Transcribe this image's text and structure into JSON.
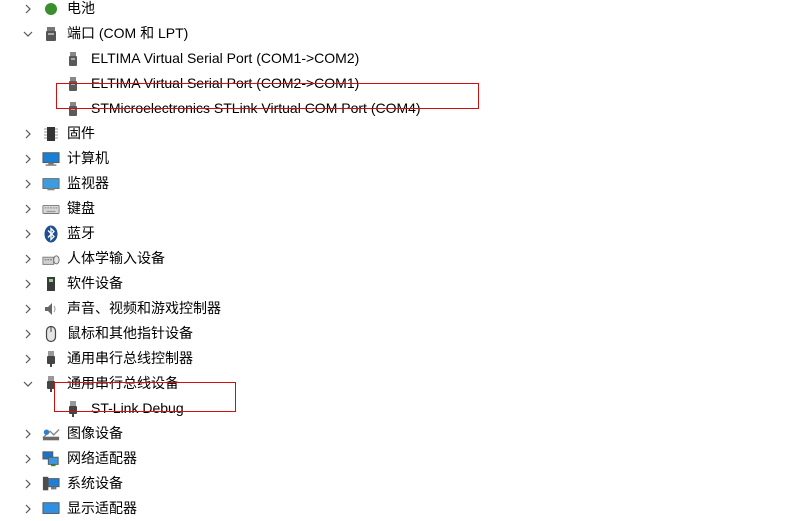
{
  "tree": {
    "items": [
      {
        "label": "电池",
        "icon": "battery-icon",
        "expanded": false
      },
      {
        "label": "端口 (COM 和 LPT)",
        "icon": "port-icon",
        "expanded": true
      },
      {
        "label": "ELTIMA Virtual Serial Port (COM1->COM2)",
        "icon": "port-icon"
      },
      {
        "label": "ELTIMA Virtual Serial Port (COM2->COM1)",
        "icon": "port-icon"
      },
      {
        "label": "STMicroelectronics STLink Virtual COM Port (COM4)",
        "icon": "port-icon",
        "highlighted": true
      },
      {
        "label": "固件",
        "icon": "firmware-icon",
        "expanded": false
      },
      {
        "label": "计算机",
        "icon": "computer-icon",
        "expanded": false
      },
      {
        "label": "监视器",
        "icon": "monitor-icon",
        "expanded": false
      },
      {
        "label": "键盘",
        "icon": "keyboard-icon",
        "expanded": false
      },
      {
        "label": "蓝牙",
        "icon": "bluetooth-icon",
        "expanded": false
      },
      {
        "label": "人体学输入设备",
        "icon": "hid-icon",
        "expanded": false
      },
      {
        "label": "软件设备",
        "icon": "software-device-icon",
        "expanded": false
      },
      {
        "label": "声音、视频和游戏控制器",
        "icon": "speaker-icon",
        "expanded": false
      },
      {
        "label": "鼠标和其他指针设备",
        "icon": "mouse-icon",
        "expanded": false
      },
      {
        "label": "通用串行总线控制器",
        "icon": "usb-icon",
        "expanded": false
      },
      {
        "label": "通用串行总线设备",
        "icon": "usb-icon",
        "expanded": true
      },
      {
        "label": "ST-Link Debug",
        "icon": "usb-icon",
        "highlighted": true
      },
      {
        "label": "图像设备",
        "icon": "camera-icon",
        "expanded": false
      },
      {
        "label": "网络适配器",
        "icon": "network-adapter-icon",
        "expanded": false
      },
      {
        "label": "系统设备",
        "icon": "system-device-icon",
        "expanded": false
      },
      {
        "label": "显示适配器",
        "icon": "display-adapter-icon",
        "expanded": false
      }
    ]
  },
  "colors": {
    "highlight_border": "#d20f0f",
    "chevron": "#555555"
  }
}
